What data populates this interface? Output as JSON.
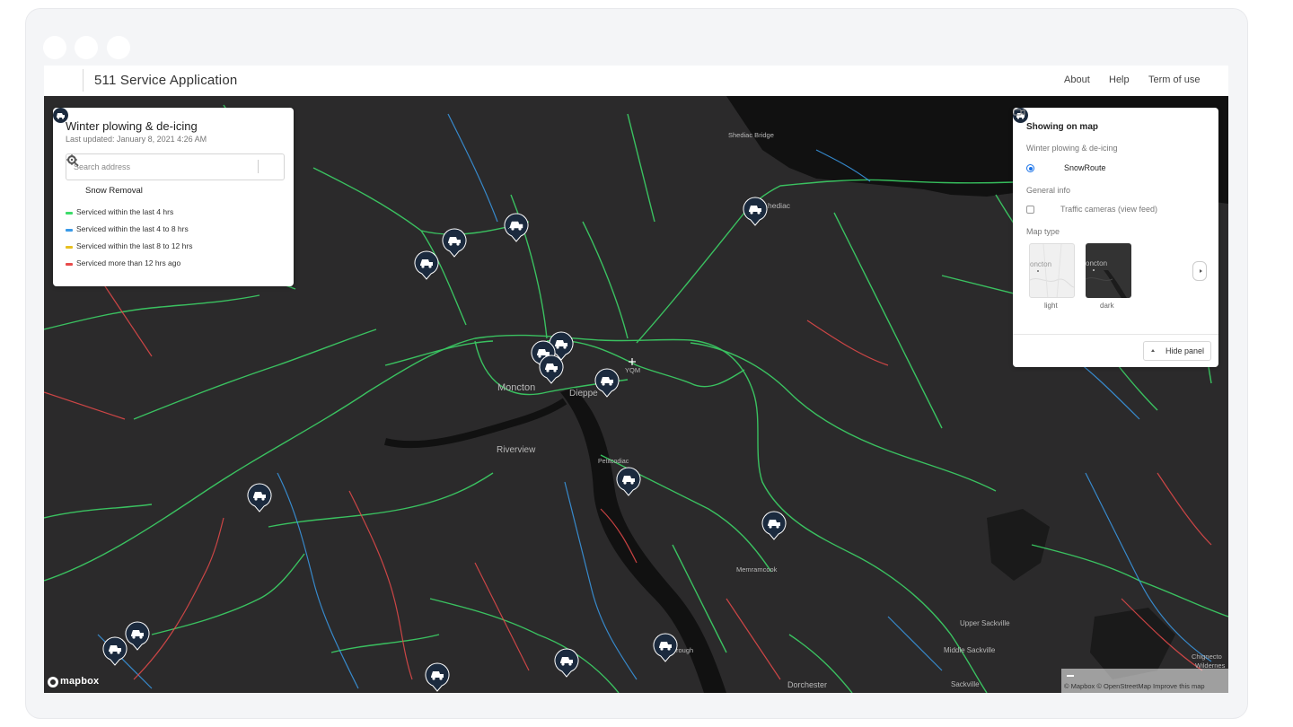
{
  "header": {
    "title": "511 Service Application",
    "nav": [
      "About",
      "Help",
      "Term of use"
    ]
  },
  "legend": {
    "title": "Winter plowing & de-icing",
    "last_updated": "Last updated: January 8, 2021 4:26 AM",
    "search_placeholder": "Search address",
    "layer_label": "Snow Removal",
    "items": [
      {
        "label": "Serviced within the last 4 hrs",
        "color": "#3ddc6a"
      },
      {
        "label": "Serviced within the last 4 to 8 hrs",
        "color": "#3a9ae8"
      },
      {
        "label": "Serviced within the last 8 to 12 hrs",
        "color": "#e8c020"
      },
      {
        "label": "Serviced more than 12 hrs ago",
        "color": "#e84a4a"
      }
    ]
  },
  "showing_panel": {
    "title": "Showing on map",
    "section_winter": "Winter plowing & de-icing",
    "snowroute_label": "SnowRoute",
    "section_general": "General info",
    "cameras_label": "Traffic cameras (view feed)",
    "section_maptype": "Map type",
    "thumb_place": "oncton",
    "map_types": [
      "light",
      "dark"
    ],
    "selected_map_type": "dark",
    "hide_label": "Hide panel"
  },
  "map": {
    "places": [
      "Moncton",
      "Dieppe",
      "Riverview",
      "YQM",
      "Shediac Bridge",
      "hediac",
      "Memramcook",
      "Upper Sackville",
      "Middle Sackville",
      "Sackville",
      "Dorchester",
      "Chignecto",
      "Wildernes",
      "Petitcodiac",
      "rough"
    ],
    "logo": "mapbox",
    "attribution": "© Mapbox © OpenStreetMap Improve this map",
    "colors": {
      "background": "#2b2a2b",
      "water": "#111111",
      "marker": "#1b2a3e"
    }
  }
}
